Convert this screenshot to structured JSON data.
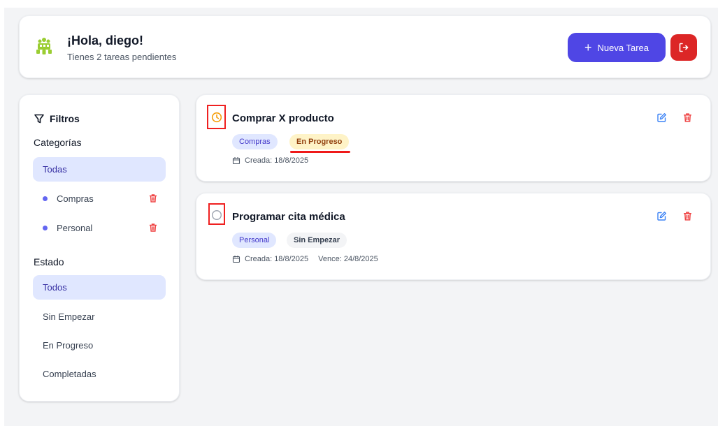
{
  "header": {
    "greeting": "¡Hola, diego!",
    "pending": "Tienes 2 tareas pendientes",
    "new_task_label": "Nueva Tarea",
    "new_task_icon": "plus-icon",
    "logout_icon": "logout-icon"
  },
  "sidebar": {
    "title": "Filtros",
    "title_icon": "filter-icon",
    "categories_label": "Categorías",
    "categories": [
      {
        "label": "Todas",
        "active": true
      },
      {
        "label": "Compras",
        "color": "#6366f1",
        "deletable": true
      },
      {
        "label": "Personal",
        "color": "#6366f1",
        "deletable": true
      }
    ],
    "status_label": "Estado",
    "statuses": [
      {
        "label": "Todos",
        "active": true
      },
      {
        "label": "Sin Empezar"
      },
      {
        "label": "En Progreso"
      },
      {
        "label": "Completadas"
      }
    ]
  },
  "tasks": [
    {
      "title": "Comprar X producto",
      "category": "Compras",
      "status": "En Progreso",
      "status_icon": "clock-icon",
      "created": "Creada: 18/8/2025",
      "due": ""
    },
    {
      "title": "Programar cita médica",
      "category": "Personal",
      "status": "Sin Empezar",
      "status_icon": "empty-circle-icon",
      "created": "Creada: 18/8/2025",
      "due": "Vence: 24/8/2025"
    }
  ],
  "colors": {
    "accent": "#4f46e5",
    "danger": "#dc2626",
    "active_filter_bg": "#e0e7ff",
    "in_progress_bg": "#fef3c7",
    "annotation": "#ef2020"
  }
}
